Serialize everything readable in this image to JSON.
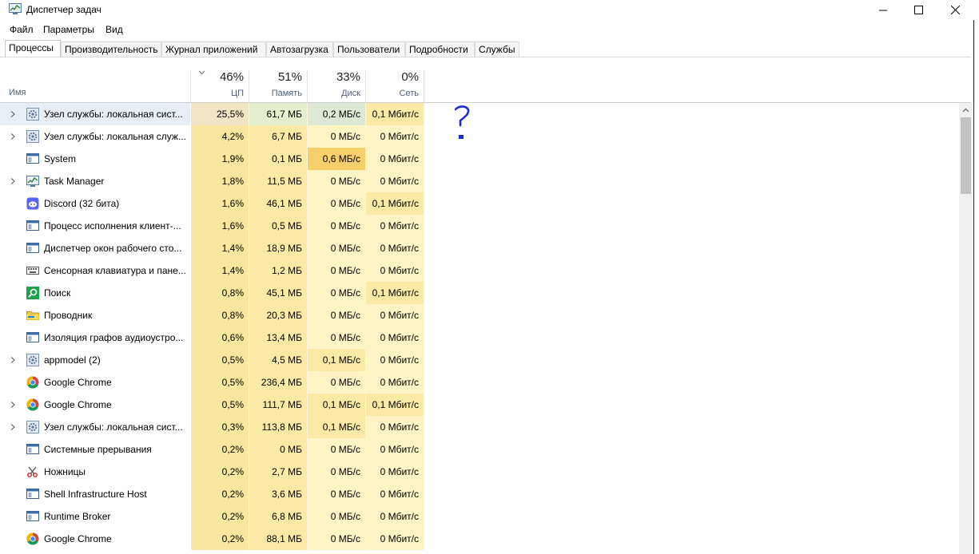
{
  "window": {
    "title": "Диспетчер задач",
    "minimize_glyph": "—",
    "maximize_glyph": "☐",
    "close_glyph": "✕"
  },
  "menu": [
    "Файл",
    "Параметры",
    "Вид"
  ],
  "tabs": [
    {
      "label": "Процессы",
      "active": true
    },
    {
      "label": "Производительность"
    },
    {
      "label": "Журнал приложений"
    },
    {
      "label": "Автозагрузка"
    },
    {
      "label": "Пользователи"
    },
    {
      "label": "Подробности"
    },
    {
      "label": "Службы"
    }
  ],
  "columns": {
    "name": "Имя",
    "cpu": {
      "pct": "46%",
      "label": "ЦП"
    },
    "memory": {
      "pct": "51%",
      "label": "Память"
    },
    "disk": {
      "pct": "33%",
      "label": "Диск"
    },
    "network": {
      "pct": "0%",
      "label": "Сеть"
    }
  },
  "colors": {
    "heat_light": "#fff4c4",
    "heat_mid": "#fbeaa5",
    "heat_cpu": "#f9e79f",
    "heat_disk_hot": "#f9cf6b",
    "row_selected": "#f1e5c4",
    "memory_selected": "#e4efcf",
    "disk_selected": "#dde9d6"
  },
  "processes": [
    {
      "name": "Узел службы: локальная сист...",
      "icon": "gear-icon",
      "expandable": true,
      "cpu": "25,5%",
      "memory": "61,7 МБ",
      "disk": "0,2 МБ/с",
      "network": "0,1 Мбит/с",
      "selected": true
    },
    {
      "name": "Узел службы: локальная служ...",
      "icon": "gear-icon",
      "expandable": true,
      "cpu": "4,2%",
      "memory": "6,7 МБ",
      "disk": "0 МБ/с",
      "network": "0 Мбит/с"
    },
    {
      "name": "System",
      "icon": "window-icon",
      "expandable": false,
      "cpu": "1,9%",
      "memory": "0,1 МБ",
      "disk": "0,6 МБ/с",
      "network": "0 Мбит/с",
      "disk_hot": true
    },
    {
      "name": "Task Manager",
      "icon": "taskmanager-icon",
      "expandable": true,
      "cpu": "1,8%",
      "memory": "11,5 МБ",
      "disk": "0 МБ/с",
      "network": "0 Мбит/с"
    },
    {
      "name": "Discord (32 бита)",
      "icon": "discord-icon",
      "expandable": false,
      "cpu": "1,6%",
      "memory": "46,1 МБ",
      "disk": "0 МБ/с",
      "network": "0,1 Мбит/с"
    },
    {
      "name": "Процесс исполнения клиент-...",
      "icon": "window-icon",
      "expandable": false,
      "cpu": "1,6%",
      "memory": "0,5 МБ",
      "disk": "0 МБ/с",
      "network": "0 Мбит/с"
    },
    {
      "name": "Диспетчер окон рабочего сто...",
      "icon": "window-icon",
      "expandable": false,
      "cpu": "1,4%",
      "memory": "18,9 МБ",
      "disk": "0 МБ/с",
      "network": "0 Мбит/с"
    },
    {
      "name": "Сенсорная клавиатура и пане...",
      "icon": "keyboard-icon",
      "expandable": false,
      "cpu": "1,4%",
      "memory": "1,2 МБ",
      "disk": "0 МБ/с",
      "network": "0 Мбит/с"
    },
    {
      "name": "Поиск",
      "icon": "search-icon",
      "expandable": false,
      "cpu": "0,8%",
      "memory": "45,1 МБ",
      "disk": "0 МБ/с",
      "network": "0,1 Мбит/с"
    },
    {
      "name": "Проводник",
      "icon": "folder-icon",
      "expandable": false,
      "cpu": "0,8%",
      "memory": "20,3 МБ",
      "disk": "0 МБ/с",
      "network": "0 Мбит/с"
    },
    {
      "name": "Изоляция графов аудиоустро...",
      "icon": "window-icon",
      "expandable": false,
      "cpu": "0,6%",
      "memory": "13,4 МБ",
      "disk": "0 МБ/с",
      "network": "0 Мбит/с"
    },
    {
      "name": "appmodel (2)",
      "icon": "gear-icon",
      "expandable": true,
      "cpu": "0,5%",
      "memory": "4,5 МБ",
      "disk": "0,1 МБ/с",
      "network": "0 Мбит/с"
    },
    {
      "name": "Google Chrome",
      "icon": "chrome-icon",
      "expandable": false,
      "cpu": "0,5%",
      "memory": "236,4 МБ",
      "disk": "0 МБ/с",
      "network": "0 Мбит/с"
    },
    {
      "name": "Google Chrome",
      "icon": "chrome-icon",
      "expandable": true,
      "cpu": "0,5%",
      "memory": "111,7 МБ",
      "disk": "0,1 МБ/с",
      "network": "0,1 Мбит/с"
    },
    {
      "name": "Узел службы: локальная сист...",
      "icon": "gear-icon",
      "expandable": true,
      "cpu": "0,3%",
      "memory": "113,8 МБ",
      "disk": "0,1 МБ/с",
      "network": "0 Мбит/с"
    },
    {
      "name": "Системные прерывания",
      "icon": "window-icon",
      "expandable": false,
      "cpu": "0,2%",
      "memory": "0 МБ",
      "disk": "0 МБ/с",
      "network": "0 Мбит/с"
    },
    {
      "name": "Ножницы",
      "icon": "scissors-icon",
      "expandable": false,
      "cpu": "0,2%",
      "memory": "2,7 МБ",
      "disk": "0 МБ/с",
      "network": "0 Мбит/с"
    },
    {
      "name": "Shell Infrastructure Host",
      "icon": "window-icon",
      "expandable": false,
      "cpu": "0,2%",
      "memory": "3,6 МБ",
      "disk": "0 МБ/с",
      "network": "0 Мбит/с"
    },
    {
      "name": "Runtime Broker",
      "icon": "window-icon",
      "expandable": false,
      "cpu": "0,2%",
      "memory": "6,8 МБ",
      "disk": "0 МБ/с",
      "network": "0 Мбит/с"
    },
    {
      "name": "Google Chrome",
      "icon": "chrome-icon",
      "expandable": false,
      "cpu": "0,2%",
      "memory": "88,1 МБ",
      "disk": "0 МБ/с",
      "network": "0 Мбит/с"
    }
  ]
}
